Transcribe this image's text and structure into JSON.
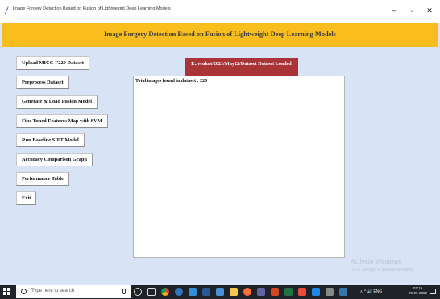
{
  "window": {
    "title": "Image Forgery Detection Based on Fusion of Lightweight Deep Learning Models",
    "minimize_glyph": "–",
    "maximize_glyph": "▫",
    "close_glyph": "✕"
  },
  "header": {
    "heading": "Image Forgery Detection Based on Fusion of Lightweight Deep Learning Models",
    "background": "#f9be1d"
  },
  "buttons": [
    {
      "label": "Upload MICC-F220 Dataset"
    },
    {
      "label": "Preprocess Dataset"
    },
    {
      "label": "Generate & Load Fusion Model"
    },
    {
      "label": "Fine Tuned Features Map with SVM"
    },
    {
      "label": "Run Baseline SIFT Model"
    },
    {
      "label": "Accuracy Comparison Graph"
    },
    {
      "label": "Performance Table"
    },
    {
      "label": "Exit"
    }
  ],
  "status": {
    "text": "E:/venkat/2021/May22/Dataset Dataset Loaded",
    "background": "#a93438"
  },
  "output": {
    "lines": [
      "Total images found in dataset : 220"
    ]
  },
  "watermark": {
    "line1": "Activate Windows",
    "line2": "Go to Settings to activate Windows."
  },
  "taskbar": {
    "search_placeholder": "Type here to search",
    "tray_text": "ㅅ ^ 🔊 ENG",
    "time": "01:19",
    "date": "05-06-2022",
    "icons": [
      "cortana-icon",
      "task-view-icon",
      "chrome-icon",
      "edge-icon",
      "store-icon",
      "word-icon",
      "mail-icon",
      "explorer-icon",
      "firefox-icon",
      "teams-icon",
      "powerpoint-icon",
      "excel-icon",
      "paint-icon",
      "photos-icon",
      "code-icon",
      "python-icon"
    ]
  }
}
